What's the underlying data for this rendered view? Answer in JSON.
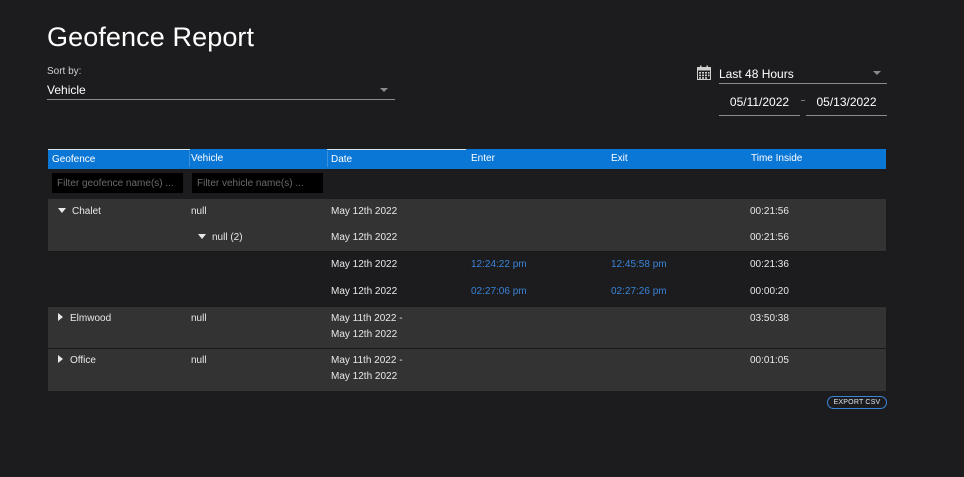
{
  "page": {
    "title": "Geofence Report"
  },
  "sort": {
    "label": "Sort by:",
    "value": "Vehicle"
  },
  "range": {
    "value": "Last 48 Hours",
    "start": "05/11/2022",
    "end": "05/13/2022"
  },
  "table": {
    "headers": [
      "Geofence",
      "Vehicle",
      "Date",
      "Enter",
      "Exit",
      "Time Inside"
    ],
    "filters": {
      "geofence_placeholder": "Filter geofence name(s) ...",
      "vehicle_placeholder": "Filter vehicle name(s) ..."
    },
    "groups": [
      {
        "geofence": "Chalet",
        "vehicle": "null",
        "date": "May 12th 2022",
        "time_inside": "00:21:56",
        "subgroup": {
          "vehicle": "null (2)",
          "date": "May 12th 2022",
          "time_inside": "00:21:56"
        },
        "visits": [
          {
            "date": "May 12th 2022",
            "enter": "12:24:22 pm",
            "exit": "12:45:58 pm",
            "time_inside": "00:21:36"
          },
          {
            "date": "May 12th 2022",
            "enter": "02:27:06 pm",
            "exit": "02:27:26 pm",
            "time_inside": "00:00:20"
          }
        ]
      },
      {
        "geofence": "Elmwood",
        "vehicle": "null",
        "date_from": "May 11th 2022 -",
        "date_to": "May 12th 2022",
        "time_inside": "03:50:38"
      },
      {
        "geofence": "Office",
        "vehicle": "null",
        "date_from": "May 11th 2022 -",
        "date_to": "May 12th 2022",
        "time_inside": "00:01:05"
      }
    ]
  },
  "actions": {
    "export_label": "EXPORT CSV"
  },
  "icons": {
    "calendar": "calendar-icon",
    "dropdown": "chevron-down-icon",
    "expanded": "caret-down-icon",
    "collapsed": "caret-right-icon"
  },
  "colors": {
    "background": "#1c1c1e",
    "accent": "#0a76d6",
    "link": "#3a84d8"
  }
}
